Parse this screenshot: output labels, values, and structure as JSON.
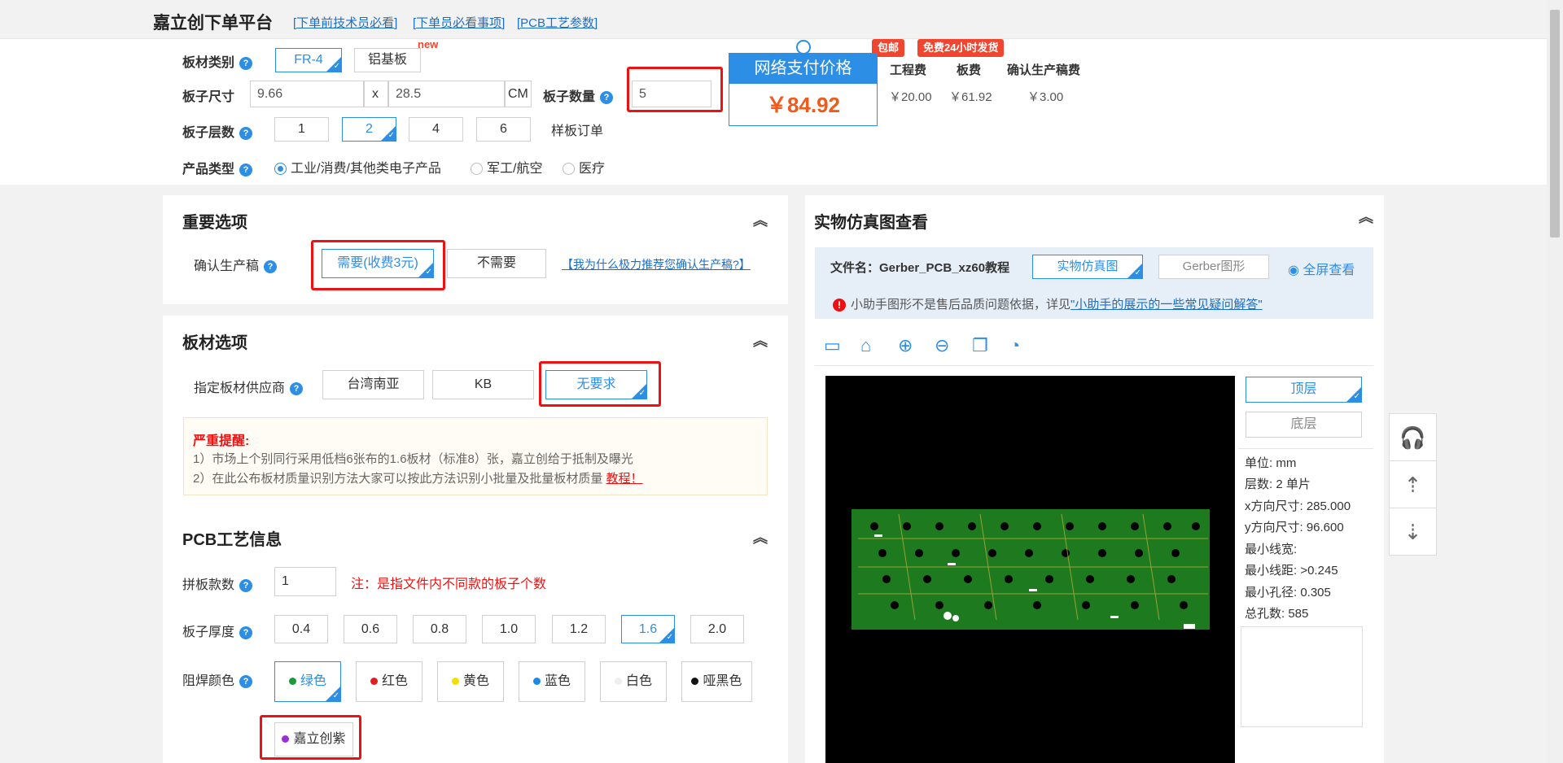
{
  "header": {
    "brand": "嘉立创下单平台",
    "links": [
      "[下单前技术员必看]",
      "[下单员必看事项]",
      "[PCB工艺参数]"
    ]
  },
  "config": {
    "material_label": "板材类别",
    "material_options": [
      "FR-4",
      "铝基板"
    ],
    "material_new_badge": "new",
    "size_label": "板子尺寸",
    "size_w": "9.66",
    "size_x": "x",
    "size_h": "28.5",
    "size_unit": "CM",
    "qty_label": "板子数量",
    "qty_value": "5",
    "layers_label": "板子层数",
    "layers_options": [
      "1",
      "2",
      "4",
      "6"
    ],
    "sample_order": "样板订单",
    "product_label": "产品类型",
    "product_options": [
      "工业/消费/其他类电子产品",
      "军工/航空",
      "医疗"
    ]
  },
  "price": {
    "tag_free_ship": "包邮",
    "tag_fast": "免费24小时发货",
    "header": "网络支付价格",
    "value": "￥84.92",
    "fee_headers": [
      "工程费",
      "板费",
      "确认生产稿费"
    ],
    "fee_values": [
      "￥20.00",
      "￥61.92",
      "￥3.00"
    ]
  },
  "important": {
    "title": "重要选项",
    "confirm_label": "确认生产稿",
    "options": [
      "需要(收费3元)",
      "不需要"
    ],
    "why_link": "【我为什么极力推荐您确认生产稿?】"
  },
  "board": {
    "title": "板材选项",
    "supplier_label": "指定板材供应商",
    "suppliers": [
      "台湾南亚",
      "KB",
      "无要求"
    ],
    "warn_title": "严重提醒:",
    "warn_line1": "1）市场上个别同行采用低档6张布的1.6板材（标准8）张，嘉立创给于抵制及曝光",
    "warn_line2": "2）在此公布板材质量识别方法大家可以按此方法识别小批量及批量板材质量",
    "warn_link": "教程！"
  },
  "pcb": {
    "title": "PCB工艺信息",
    "panel_label": "拼板款数",
    "panel_value": "1",
    "panel_note": "注：是指文件内不同款的板子个数",
    "thickness_label": "板子厚度",
    "thickness_options": [
      "0.4",
      "0.6",
      "0.8",
      "1.0",
      "1.2",
      "1.6",
      "2.0"
    ],
    "color_label": "阻焊颜色",
    "colors": [
      {
        "name": "绿色",
        "hex": "#1a9a3a"
      },
      {
        "name": "红色",
        "hex": "#e41e1e"
      },
      {
        "name": "黄色",
        "hex": "#f2e100"
      },
      {
        "name": "蓝色",
        "hex": "#1e88e5"
      },
      {
        "name": "白色",
        "hex": "#eeeeee"
      },
      {
        "name": "哑黑色",
        "hex": "#111111"
      },
      {
        "name": "嘉立创紫",
        "hex": "#9b30d9"
      }
    ]
  },
  "preview": {
    "title": "实物仿真图查看",
    "file_label": "文件名：Gerber_PCB_xz60教程",
    "tab_sim": "实物仿真图",
    "tab_gerber": "Gerber图形",
    "fullscreen": "全屏查看",
    "notice": "小助手图形不是售后品质问题依据，详见",
    "notice_link": "\"小助手的展示的一些常见疑问解答\"",
    "layer_top": "顶层",
    "layer_bottom": "底层",
    "info": [
      "单位:  mm",
      "层数:  2    单片",
      "x方向尺寸:  285.000",
      "y方向尺寸:  96.600",
      "最小线宽:",
      "最小线距:  >0.245",
      "最小孔径:  0.305",
      "总孔数:  585"
    ]
  },
  "colors": {
    "accent": "#2c8fe5",
    "price": "#f05a1a",
    "highlight": "#e11111",
    "pcb_green": "#1e7a1e"
  }
}
